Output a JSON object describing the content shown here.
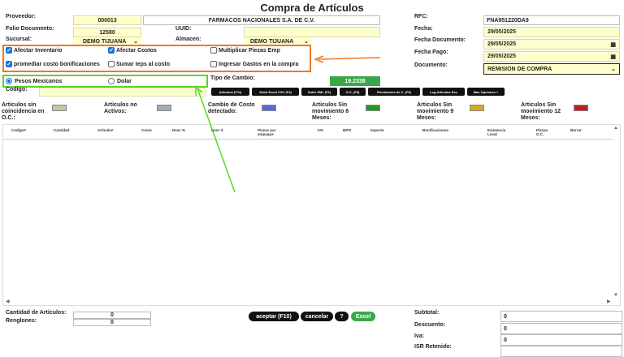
{
  "page": {
    "title": "Compra de Artículos"
  },
  "header": {
    "proveedor_label": "Proveedor:",
    "proveedor_code": "000013",
    "proveedor_name": "FARMACOS NACIONALES S.A. DE C.V.",
    "folio_label": "Folio Documento:",
    "folio_value": "12580",
    "uuid_label": "UUID:",
    "uuid_value": "",
    "sucursal_label": "Sucursal:",
    "sucursal_value": "DEMO TIJUANA",
    "almacen_label": "Almacen:",
    "almacen_value": "DEMO TIJUANA",
    "rfc_label": "RFC:",
    "rfc_value": "FNA951220DA9",
    "fecha_label": "Fecha:",
    "fecha_value": "29/05/2025",
    "fecha_doc_label": "Fecha Documento:",
    "fecha_doc_value": "29/05/2025",
    "fecha_pago_label": "Fecha Pago:",
    "fecha_pago_value": "29/05/2025",
    "documento_label": "Documento:",
    "documento_value": "REMISION DE COMPRA"
  },
  "options": {
    "afectar_inventario": "Afectar Inventario",
    "afectar_costos": "Afectar Costos",
    "multiplicar_piezas": "Multiplicar Piezas Emp",
    "promediar_costo": "promediar costo bonificaciones",
    "sumar_ieps": "Sumar Ieps al costo",
    "ingresar_gastos": "Ingresar Gastos en la compra"
  },
  "currency": {
    "pesos": "Pesos Mexicanos",
    "dolar": "Dolar",
    "tipo_cambio_label": "Tipo de Cambio:",
    "tipo_cambio_value": "19.2338"
  },
  "codigo_label": "Codigo:",
  "toolbar": {
    "articulos": "Articulos (F11)",
    "subir_excel": "Subir Excel CSV (F4)",
    "subir_xml": "Subir XML (F6)",
    "oc": "O.C. (F8)",
    "remisiones": "Remisiones de C. (F9)",
    "log": "Log Articulos Exc",
    "mas_opciones": "Mas Opciones +"
  },
  "legend": {
    "sin_coincidencia": "Articulos sin coincidencia en O.C.:",
    "no_activos": "Articulos no Activos:",
    "cambio_costo": "Cambio de Costo detectado:",
    "sin_mov_6": "Articulos Sin movimiento 6 Meses:",
    "sin_mov_9": "Articulos Sin movimiento 9 Meses:",
    "sin_mov_12": "Articulos Sin movimiento 12 Meses:",
    "colors": {
      "sin_coincidencia": "#c8c4a4",
      "no_activos": "#a4acb8",
      "cambio_costo": "#5a6ad8",
      "sin_mov_6": "#1e9a1e",
      "sin_mov_9": "#d8a81e",
      "sin_mov_12": "#c01e1e"
    }
  },
  "table": {
    "columns": [
      "Codigo#",
      "Cantidad",
      "Articulo#",
      "Costo",
      "Desc %",
      "Desc $",
      "Piezas por empaque",
      "IVA",
      "IEPS",
      "Importe",
      "Bonificaciones",
      "Existencia Local",
      "Piezas O.C.",
      "Borrar"
    ]
  },
  "footer": {
    "cantidad_label": "Cantidad de Articulos:",
    "cantidad_value": "0",
    "renglones_label": "Renglones:",
    "renglones_value": "0",
    "aceptar": "aceptar (F10)",
    "cancelar": "cancelar",
    "help": "?",
    "excel": "Excel",
    "subtotal_label": "Subtotal:",
    "subtotal_value": "0",
    "descuento_label": "Descuento:",
    "descuento_value": "0",
    "iva_label": "Iva:",
    "iva_value": "0",
    "isr_label": "ISR Retenido:"
  }
}
